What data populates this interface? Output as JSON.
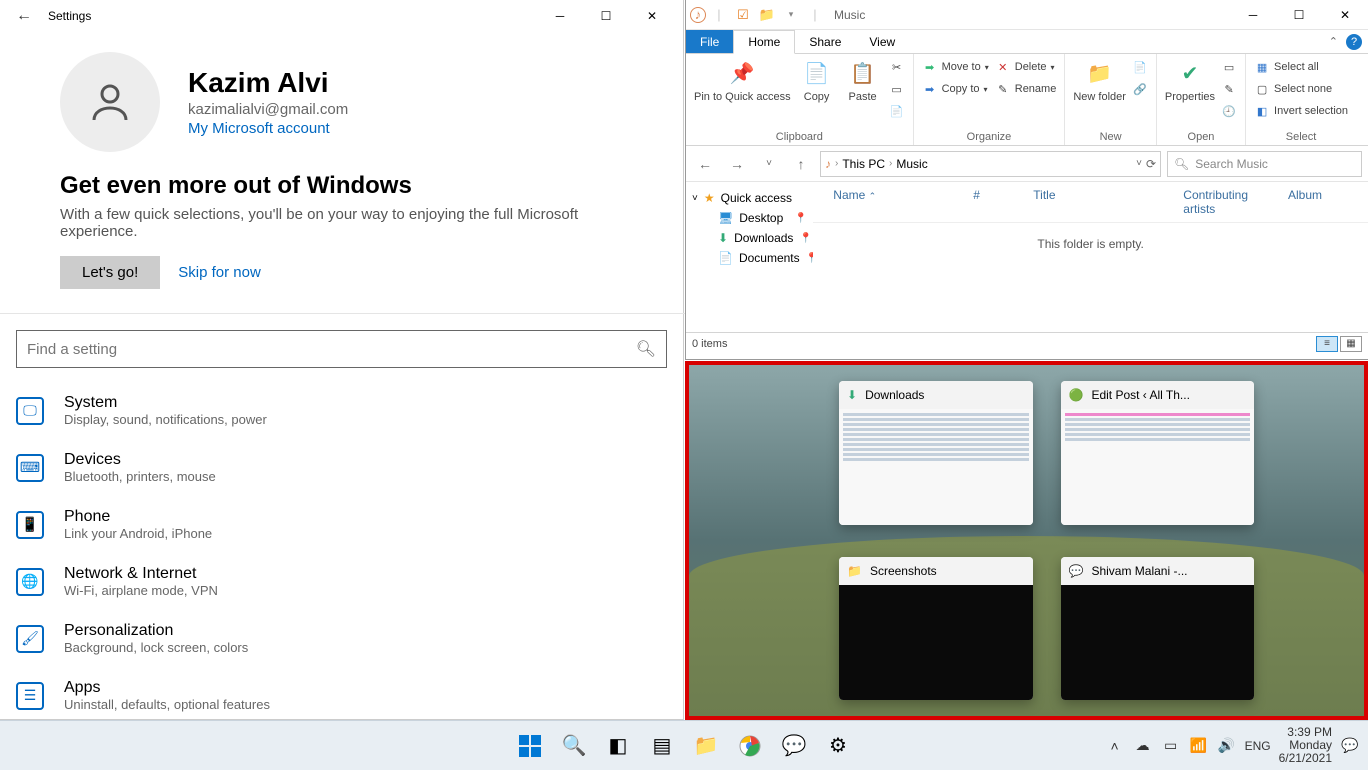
{
  "settings": {
    "title": "Settings",
    "user": {
      "name": "Kazim Alvi",
      "email": "kazimalialvi@gmail.com",
      "account_link": "My Microsoft account"
    },
    "promo": {
      "headline": "Get even more out of Windows",
      "sub": "With a few quick selections, you'll be on your way to enjoying the full Microsoft experience.",
      "cta": "Let's go!",
      "skip": "Skip for now"
    },
    "search_placeholder": "Find a setting",
    "categories": [
      {
        "title": "System",
        "desc": "Display, sound, notifications, power"
      },
      {
        "title": "Devices",
        "desc": "Bluetooth, printers, mouse"
      },
      {
        "title": "Phone",
        "desc": "Link your Android, iPhone"
      },
      {
        "title": "Network & Internet",
        "desc": "Wi-Fi, airplane mode, VPN"
      },
      {
        "title": "Personalization",
        "desc": "Background, lock screen, colors"
      },
      {
        "title": "Apps",
        "desc": "Uninstall, defaults, optional features"
      }
    ]
  },
  "explorer": {
    "title": "Music",
    "tabs": {
      "file": "File",
      "home": "Home",
      "share": "Share",
      "view": "View"
    },
    "ribbon": {
      "clipboard": {
        "label": "Clipboard",
        "pin": "Pin to Quick access",
        "copy": "Copy",
        "paste": "Paste",
        "cut": "Cut"
      },
      "organize": {
        "label": "Organize",
        "move": "Move to",
        "copy": "Copy to",
        "delete": "Delete",
        "rename": "Rename"
      },
      "new_group": {
        "label": "New",
        "newfolder": "New folder"
      },
      "open_group": {
        "label": "Open",
        "properties": "Properties"
      },
      "select": {
        "label": "Select",
        "all": "Select all",
        "none": "Select none",
        "invert": "Invert selection"
      }
    },
    "breadcrumbs": {
      "root": "This PC",
      "current": "Music"
    },
    "search_placeholder": "Search Music",
    "tree": {
      "quick": "Quick access",
      "desktop": "Desktop",
      "downloads": "Downloads",
      "documents": "Documents"
    },
    "columns": {
      "name": "Name",
      "num": "#",
      "title": "Title",
      "artists": "Contributing artists",
      "album": "Album"
    },
    "empty": "This folder is empty.",
    "status": "0 items"
  },
  "snap": {
    "tiles": [
      {
        "name": "Downloads"
      },
      {
        "name": "Edit Post ‹ All Th..."
      },
      {
        "name": "Screenshots"
      },
      {
        "name": "Shivam Malani -..."
      }
    ]
  },
  "taskbar": {
    "lang": "ENG",
    "time": "3:39 PM",
    "day": "Monday",
    "date": "6/21/2021"
  }
}
